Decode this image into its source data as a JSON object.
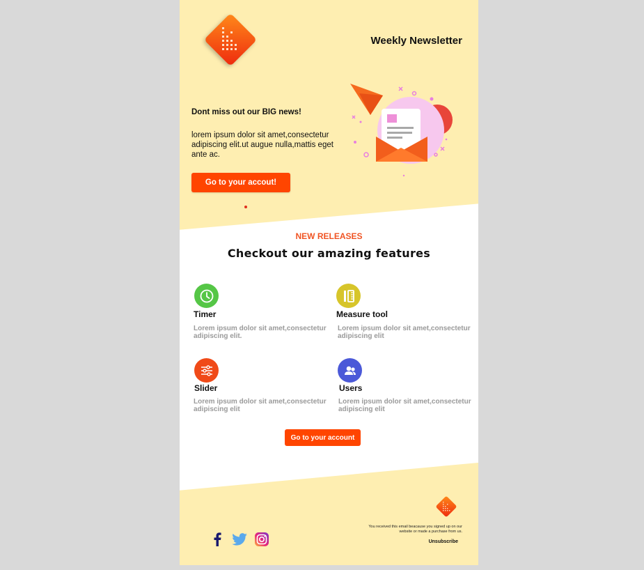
{
  "header": {
    "title": "Weekly Newsletter",
    "logo": "brand-logo"
  },
  "hero": {
    "heading": "Dont miss out  our BIG news!",
    "body": "lorem ipsum dolor sit amet,consectetur adipiscing elit.ut augue nulla,mattis eget ante ac.",
    "button_label": "Go to your accout!",
    "illustration": "paper-plane-envelope-illustration"
  },
  "features": {
    "eyebrow": "NEW RELEASES",
    "title": "Checkout our amazing features",
    "items": [
      {
        "title": "Timer",
        "desc": "Lorem ipsum dolor sit amet,consectetur adipiscing elit.",
        "icon": "clock-icon",
        "color": "#55c646"
      },
      {
        "title": "Measure tool",
        "desc": "Lorem ipsum dolor sit amet,consectetur adipiscing elit",
        "icon": "measure-icon",
        "color": "#d7c52a"
      },
      {
        "title": "Slider",
        "desc": "Lorem ipsum dolor sit amet,consectetur adipiscing elit",
        "icon": "sliders-icon",
        "color": "#f04a18"
      },
      {
        "title": "Users",
        "desc": "Lorem ipsum dolor sit amet,consectetur adipiscing elit",
        "icon": "users-icon",
        "color": "#4b59d8"
      }
    ],
    "button_label": "Go to your account"
  },
  "footer": {
    "note": "You received this email beacause you signed up on our website or made a purchase from us.",
    "unsubscribe": "Unsubscribe",
    "social": [
      "facebook-icon",
      "twitter-icon",
      "instagram-icon"
    ]
  },
  "colors": {
    "accent": "#ff4500",
    "cream": "#feeeb1",
    "backdrop": "#d9d9d9"
  }
}
